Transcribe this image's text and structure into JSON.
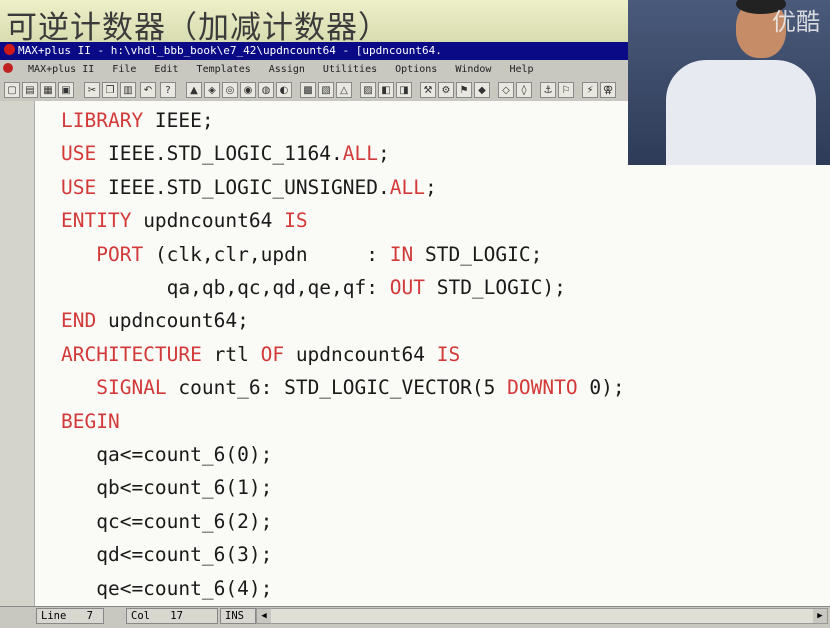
{
  "slide": {
    "title": "可逆计数器（加减计数器）"
  },
  "window": {
    "title": "MAX+plus II - h:\\vhdl_bbb_book\\e7_42\\updncount64 - [updncount64."
  },
  "menu": {
    "items": [
      "MAX+plus II",
      "File",
      "Edit",
      "Templates",
      "Assign",
      "Utilities",
      "Options",
      "Window",
      "Help"
    ]
  },
  "toolbar": {
    "icons": [
      "new-file-icon",
      "open-icon",
      "save-icon",
      "print-icon",
      "cut-icon",
      "copy-icon",
      "paste-icon",
      "undo-icon",
      "help-icon",
      "compile-icon",
      "simulate-icon",
      "timing-icon",
      "hierarchy-icon",
      "floorplan-icon",
      "programmer-icon",
      "save-check-icon",
      "project-save-icon",
      "project-compile-icon",
      "project-simulate-icon",
      "tool-a-icon",
      "tool-b-icon",
      "tool-c-icon"
    ]
  },
  "code": {
    "lines": [
      [
        {
          "t": "LIBRARY",
          "k": 1
        },
        {
          "t": " IEEE;",
          "k": 0
        }
      ],
      [
        {
          "t": "USE",
          "k": 1
        },
        {
          "t": " IEEE.STD_LOGIC_1164.",
          "k": 0
        },
        {
          "t": "ALL",
          "k": 1
        },
        {
          "t": ";",
          "k": 0
        }
      ],
      [
        {
          "t": "USE",
          "k": 1
        },
        {
          "t": " IEEE.STD_LOGIC_UNSIGNED.",
          "k": 0
        },
        {
          "t": "ALL",
          "k": 1
        },
        {
          "t": ";",
          "k": 0
        }
      ],
      [
        {
          "t": "ENTITY",
          "k": 1
        },
        {
          "t": " updncount64 ",
          "k": 0
        },
        {
          "t": "IS",
          "k": 1
        }
      ],
      [
        {
          "t": "   ",
          "k": 0
        },
        {
          "t": "PORT",
          "k": 1
        },
        {
          "t": " (clk,clr,updn     : ",
          "k": 0
        },
        {
          "t": "IN",
          "k": 1
        },
        {
          "t": " STD_LOGIC;",
          "k": 0
        }
      ],
      [
        {
          "t": "         qa,qb,qc,qd,qe,qf: ",
          "k": 0
        },
        {
          "t": "OUT",
          "k": 1
        },
        {
          "t": " STD_LOGIC);",
          "k": 0
        }
      ],
      [
        {
          "t": "END",
          "k": 1
        },
        {
          "t": " updncount64;",
          "k": 0
        }
      ],
      [
        {
          "t": "ARCHITECTURE",
          "k": 1
        },
        {
          "t": " rtl ",
          "k": 0
        },
        {
          "t": "OF",
          "k": 1
        },
        {
          "t": " updncount64 ",
          "k": 0
        },
        {
          "t": "IS",
          "k": 1
        }
      ],
      [
        {
          "t": "   ",
          "k": 0
        },
        {
          "t": "SIGNAL",
          "k": 1
        },
        {
          "t": " count_6: STD_LOGIC_VECTOR(5 ",
          "k": 0
        },
        {
          "t": "DOWNTO",
          "k": 1
        },
        {
          "t": " 0);",
          "k": 0
        }
      ],
      [
        {
          "t": "BEGIN",
          "k": 1
        }
      ],
      [
        {
          "t": "   qa<=count_6(0);",
          "k": 0
        }
      ],
      [
        {
          "t": "   qb<=count_6(1);",
          "k": 0
        }
      ],
      [
        {
          "t": "   qc<=count_6(2);",
          "k": 0
        }
      ],
      [
        {
          "t": "   qd<=count_6(3);",
          "k": 0
        }
      ],
      [
        {
          "t": "   qe<=count_6(4);",
          "k": 0
        }
      ]
    ]
  },
  "status": {
    "line_label": "Line",
    "line_value": "7",
    "col_label": "Col",
    "col_value": "17",
    "mode": "INS"
  },
  "webcam": {
    "watermark": "优酷"
  }
}
